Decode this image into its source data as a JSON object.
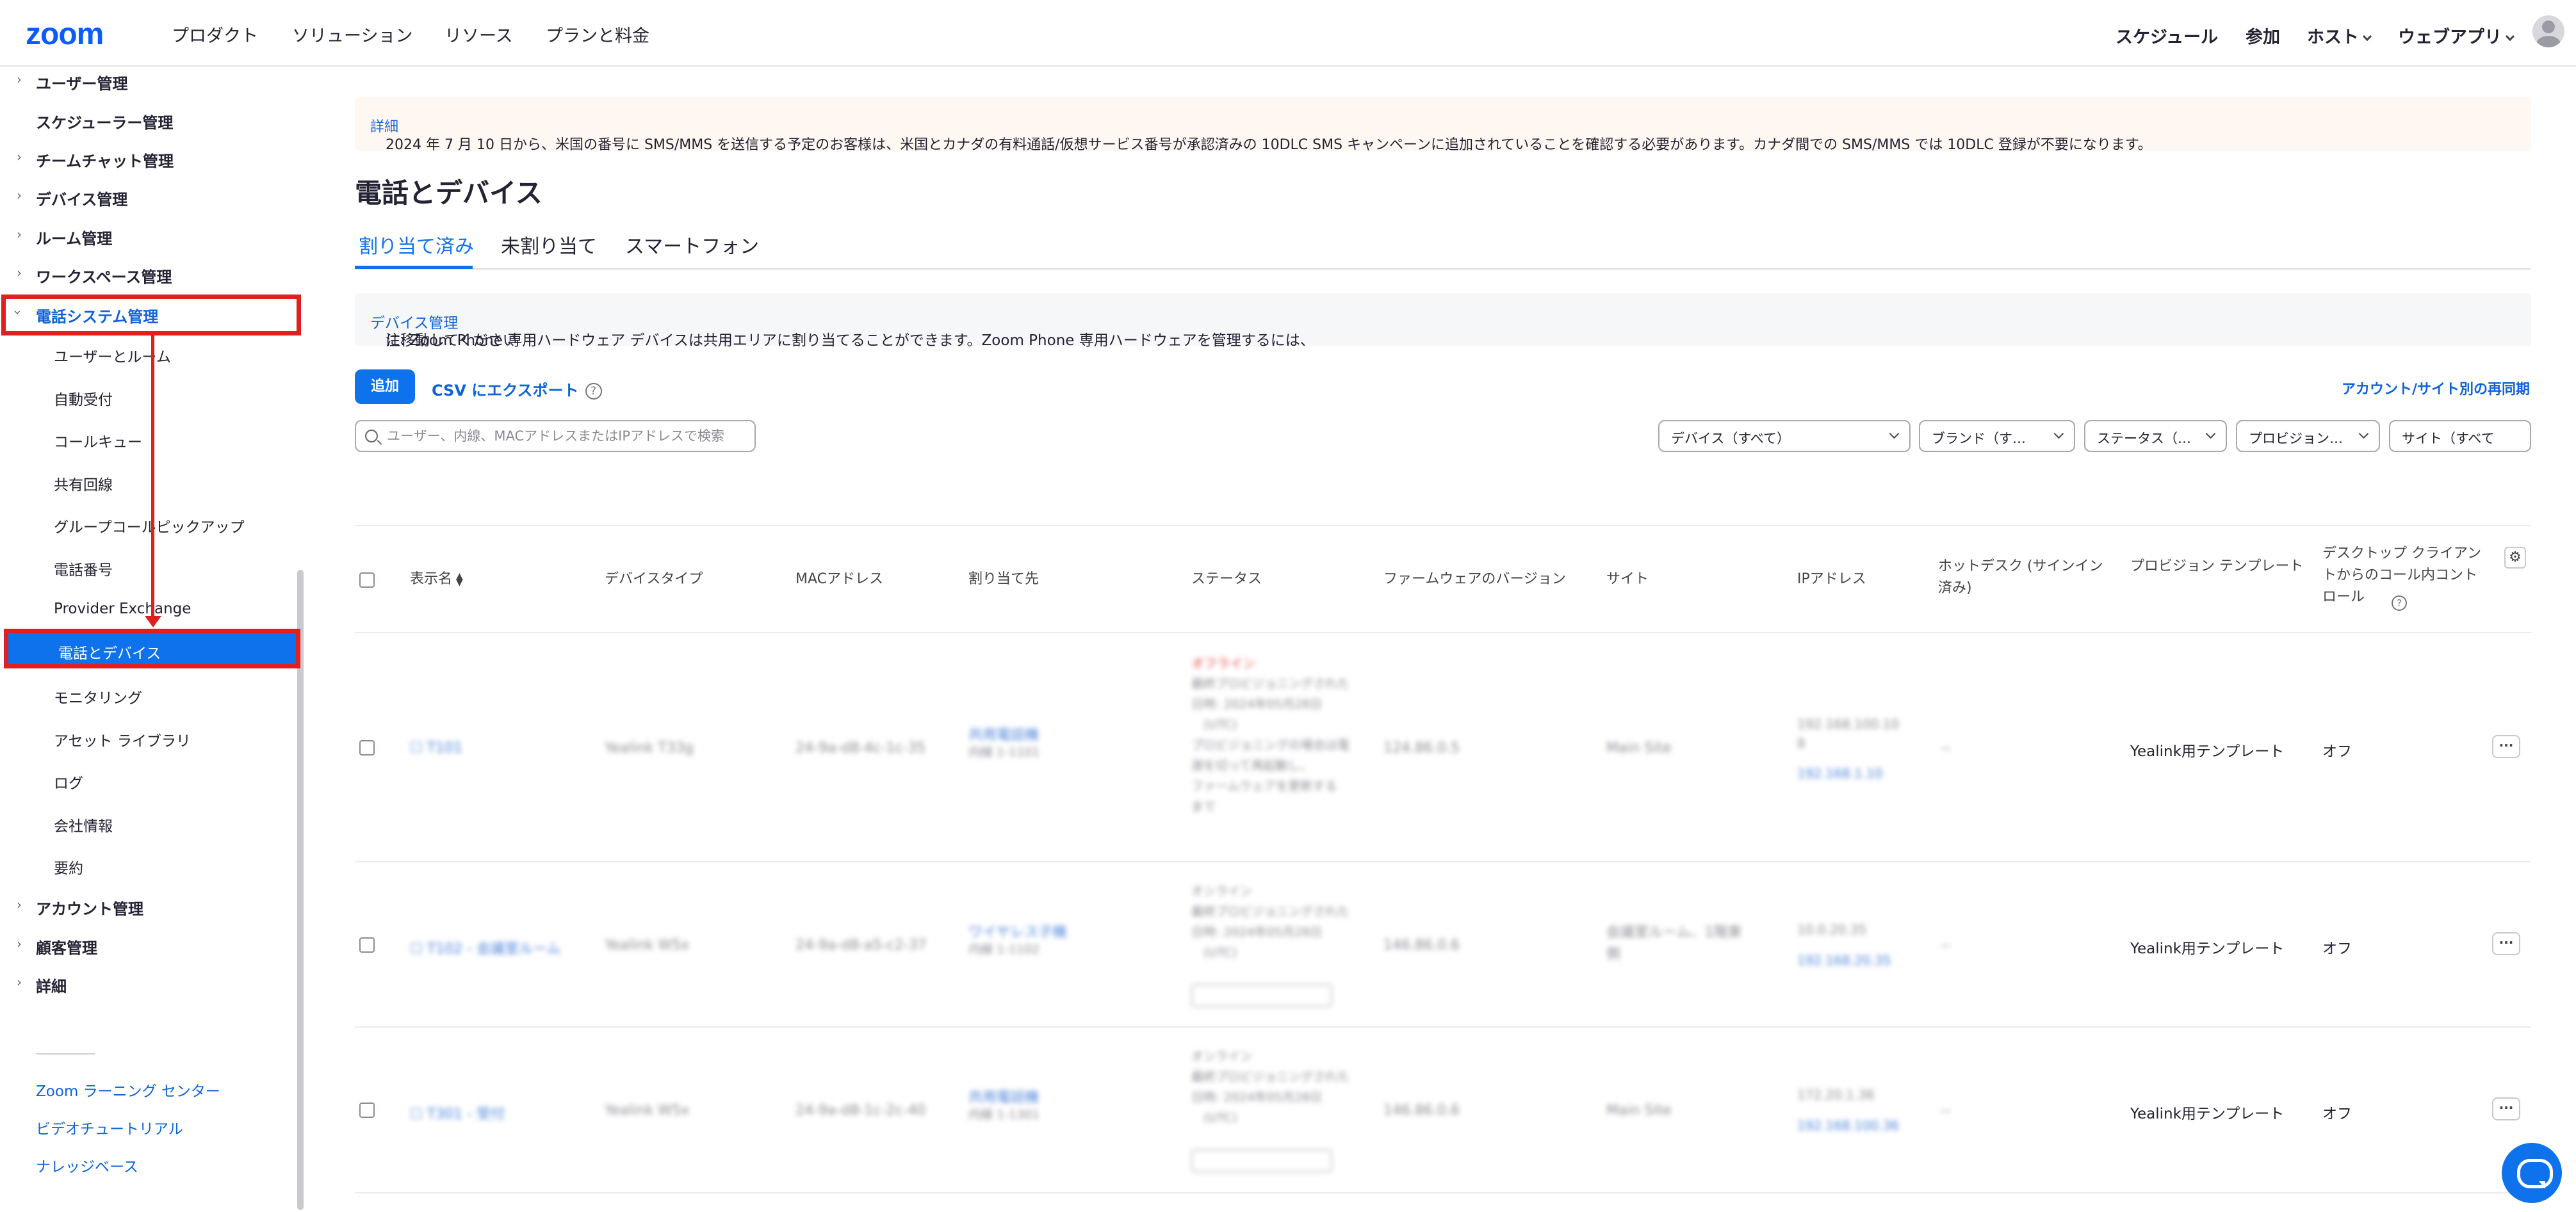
{
  "topnav": {
    "logo": "zoom",
    "left_items": [
      "プロダクト",
      "ソリューション",
      "リソース",
      "プランと料金"
    ],
    "right_items": {
      "schedule": "スケジュール",
      "join": "参加",
      "host": "ホスト",
      "webapp": "ウェブアプリ"
    }
  },
  "sidebar": {
    "top_items": [
      "ユーザー管理",
      "スケジューラー管理",
      "チームチャット管理",
      "デバイス管理",
      "ルーム管理",
      "ワークスペース管理"
    ],
    "expanded_section": "電話システム管理",
    "sub_items": [
      "ユーザーとルーム",
      "自動受付",
      "コールキュー",
      "共有回線",
      "グループコールピックアップ",
      "電話番号",
      "Provider Exchange"
    ],
    "selected_item": "電話とデバイス",
    "sub_items_after": [
      "モニタリング",
      "アセット ライブラリ",
      "ログ",
      "会社情報",
      "要約"
    ],
    "bottom_items": [
      "アカウント管理",
      "顧客管理",
      "詳細"
    ],
    "links": [
      "Zoom ラーニング センター",
      "ビデオチュートリアル",
      "ナレッジベース"
    ]
  },
  "banner": {
    "text": "2024 年 7 月 10 日から、米国の番号に SMS/MMS を送信する予定のお客様は、米国とカナダの有料通話/仮想サービス番号が承認済みの 10DLC SMS キャンペーンに追加されていることを確認する必要があります。カナダ間での SMS/MMS では 10DLC 登録が不要になります。",
    "link": "詳細"
  },
  "page": {
    "title": "電話とデバイス",
    "tabs": [
      "割り当て済み",
      "未割り当て",
      "スマートフォン"
    ]
  },
  "note": {
    "text": "注: Zoom Phone 専用ハードウェア デバイスは共用エリアに割り当てることができます。Zoom Phone 専用ハードウェアを管理するには、",
    "link": "デバイス管理",
    "suffix": "に移動してください"
  },
  "toolbar": {
    "add": "追加",
    "csv_export": "CSV にエクスポート",
    "resync": "アカウント/サイト別の再同期",
    "search_placeholder": "ユーザー、内線、MACアドレスまたはIPアドレスで検索",
    "filters": [
      "デバイス（すべて）",
      "ブランド（す…",
      "ステータス（…",
      "プロビジョン…",
      "サイト（すべて"
    ]
  },
  "table": {
    "headers": [
      "表示名",
      "デバイスタイプ",
      "MACアドレス",
      "割り当て先",
      "ステータス",
      "ファームウェアのバージョン",
      "サイト",
      "IPアドレス",
      "ホットデスク (サインイン済み)",
      "プロビジョン テンプレート",
      "デスクトップ クライアントからのコール内コントロール"
    ],
    "rows": [
      {
        "template": "Yealink用テンプレート",
        "control": "オフ"
      },
      {
        "template": "Yealink用テンプレート",
        "control": "オフ"
      },
      {
        "template": "Yealink用テンプレート",
        "control": "オフ"
      }
    ]
  },
  "colors": {
    "accent": "#0e72ed",
    "highlight": "#e02020",
    "link": "#0e63d8"
  }
}
